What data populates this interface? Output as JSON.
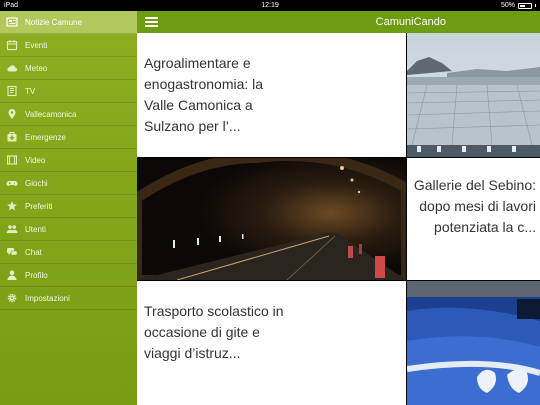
{
  "status": {
    "device": "iPad",
    "time": "12:19",
    "battery": "50%"
  },
  "app": {
    "title": "CamuniCando"
  },
  "sidebar": {
    "items": [
      {
        "label": "Notizie Camune",
        "icon": "newspaper-icon",
        "active": true
      },
      {
        "label": "Eventi",
        "icon": "calendar-icon"
      },
      {
        "label": "Meteo",
        "icon": "cloud-icon"
      },
      {
        "label": "TV",
        "icon": "tv-icon"
      },
      {
        "label": "Vallecamonica",
        "icon": "map-pin-icon"
      },
      {
        "label": "Emergenze",
        "icon": "medkit-icon"
      },
      {
        "label": "Video",
        "icon": "video-icon"
      },
      {
        "label": "Giochi",
        "icon": "gamepad-icon"
      },
      {
        "label": "Preferiti",
        "icon": "star-icon"
      },
      {
        "label": "Utenti",
        "icon": "users-icon"
      },
      {
        "label": "Chat",
        "icon": "chat-icon"
      },
      {
        "label": "Profilo",
        "icon": "user-icon"
      },
      {
        "label": "Impostazioni",
        "icon": "gear-icon"
      }
    ]
  },
  "articles": [
    {
      "title": "Agroalimentare e enogastronomia: la Valle Camonica a Sulzano per l’..."
    },
    {
      "title": "Gallerie del Sebino: dopo mesi di lavori potenziata la c..."
    },
    {
      "title": "Trasporto scolastico in occasione di gite e viaggi d’istruz..."
    }
  ],
  "colors": {
    "sidebar": "#8fae22",
    "topbar": "#6d9c12",
    "active": "#b3c85c"
  }
}
